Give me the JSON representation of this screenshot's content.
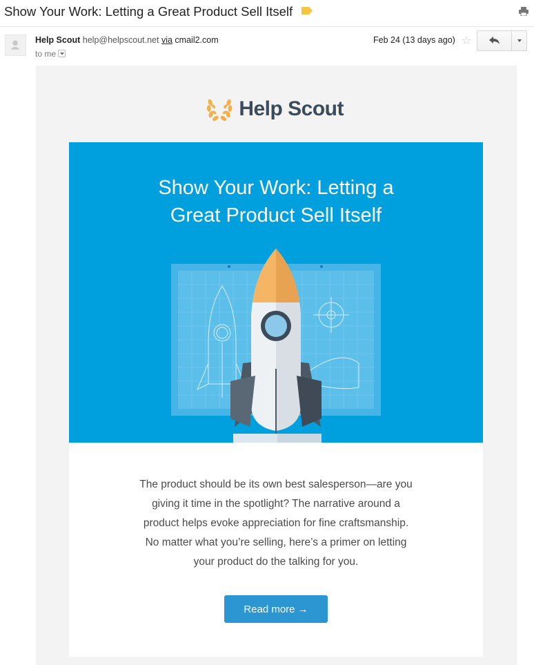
{
  "email": {
    "subject": "Show Your Work: Letting a Great Product Sell Itself",
    "sender_name": "Help Scout",
    "sender_email": "help@helpscout.net",
    "via_label": "via",
    "via_domain": "cmail2.com",
    "recipient": "to me",
    "date": "Feb 24 (13 days ago)",
    "label_color": "#f5c542"
  },
  "icons": {
    "label_tag": "label-tag-icon",
    "print": "print-icon",
    "avatar": "person-icon",
    "star": "star-icon",
    "reply": "reply-arrow-icon",
    "more": "chevron-down-icon"
  },
  "newsletter": {
    "brand": "Help Scout",
    "headline_line1": "Show Your Work: Letting a",
    "headline_line2": "Great Product Sell Itself",
    "paragraph_lines": [
      "The product should be its own best salesperson—are you",
      "giving it time in the spotlight? The narrative around a",
      "product helps evoke appreciation for fine craftsmanship.",
      "No matter what you’re selling, here’s a primer on letting",
      "your product do the talking for you."
    ],
    "cta_label": "Read more →",
    "hero_color": "#009fde",
    "cta_color": "#2c96d3",
    "brand_text_color": "#3c4b5a",
    "laurel_color": "#f0b04c"
  }
}
